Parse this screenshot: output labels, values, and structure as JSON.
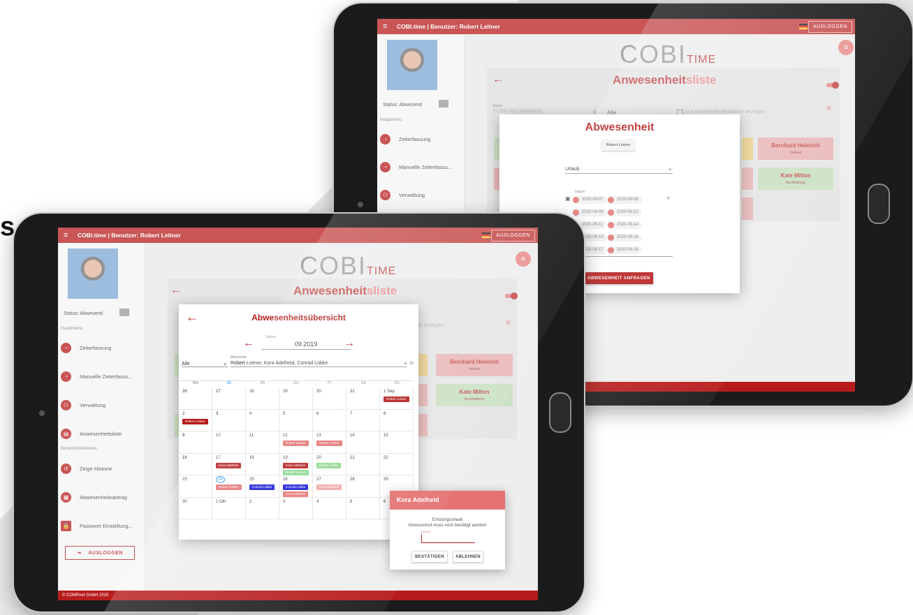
{
  "stray_letter": "s",
  "back_tablet": {
    "topbar": {
      "title": "COBI.time | Benutzer: Robert Leitner",
      "logout": "AUSLOGGEN"
    },
    "sidebar": {
      "status": "Status: Abwesend",
      "hauptmenu": "Hauptmenü",
      "items": [
        {
          "label": "Zeiterfassung",
          "icon": "clock-icon"
        },
        {
          "label": "Manuelle Zeiterfassu...",
          "icon": "edit-clock-icon"
        },
        {
          "label": "Verwaltung",
          "icon": "people-icon"
        }
      ]
    },
    "logo": {
      "main": "COBI",
      "suffix": "TIME"
    },
    "panel_title": {
      "main": "Anwesenheit",
      "rest": "sliste"
    },
    "search_label": "Suche",
    "search_placeholder": "Suche nach Mitarbeiter",
    "filter_value": "Alle",
    "only_present": "Nur anwesende Mitarbeiter anzeigen",
    "cards": [
      {
        "name": "Bernhard Heinrich",
        "dept": "Verkauf",
        "color": "#e3a5a5"
      },
      {
        "name": "Kate Milton",
        "dept": "Buchhaltung",
        "color": "#bcd9b2"
      }
    ],
    "dialog": {
      "title": "Abwesenheit",
      "user_button": "Robert Leitner",
      "type": "Urlaub",
      "date_label": "Datum",
      "dates": [
        "2020-09-07",
        "2020-09-08",
        "2020-09-09",
        "2020-09-10",
        "2020-09-11",
        "2020-09-14",
        "2020-09-15",
        "2020-09-16",
        "2020-09-17",
        "2020-09-18"
      ],
      "submit": "ABWESENHEIT ANFRAGEN"
    }
  },
  "front_tablet": {
    "topbar": {
      "title": "COBI.time | Benutzer: Robert Leitner",
      "logout": "AUSLOGGEN"
    },
    "sidebar": {
      "status": "Status: Abwesend",
      "hauptmenu": "Hauptmenü",
      "items": [
        {
          "label": "Zeiterfassung",
          "icon": "clock-icon"
        },
        {
          "label": "Manuelle Zeiterfassu...",
          "icon": "edit-clock-icon"
        },
        {
          "label": "Verwaltung",
          "icon": "people-icon"
        },
        {
          "label": "Anwesenheitsliste",
          "icon": "list-icon"
        }
      ],
      "subhead": "Benutzerfunktionen",
      "items2": [
        {
          "label": "Zeige Historie",
          "icon": "history-icon"
        },
        {
          "label": "Abwesenheitsantrag",
          "icon": "calendar-icon"
        },
        {
          "label": "Passwort Einstellung...",
          "icon": "lock-icon"
        }
      ],
      "logout": "AUSLOGGEN"
    },
    "logo": {
      "main": "COBI",
      "suffix": "TIME"
    },
    "panel_title": {
      "main": "Anwesenheit",
      "rest": "sliste"
    },
    "only_present": "er anzeigen",
    "cards": [
      {
        "name": "Bernhard Heinrich",
        "dept": "Verkauf"
      },
      {
        "name": "Kate Milton",
        "dept": "Buchhaltung"
      }
    ],
    "overview": {
      "title": "Abwesenheitsübersicht",
      "date_label": "Datum",
      "month": "09.2019",
      "filter": "Alle",
      "employees_label": "Mitarbeiter",
      "employees": "Robert Leitner, Kora Adelheid, Conrad Lübke",
      "weekdays": [
        "Mo",
        "Di",
        "Mi",
        "Do",
        "Fr",
        "Sa",
        "So"
      ],
      "weeks": [
        [
          "26",
          "27",
          "28",
          "29",
          "30",
          "31",
          "1 Sep"
        ],
        [
          "2",
          "3",
          "4",
          "5",
          "6",
          "7",
          "8"
        ],
        [
          "9",
          "10",
          "11",
          "12",
          "13",
          "14",
          "15"
        ],
        [
          "16",
          "17",
          "18",
          "19",
          "20",
          "21",
          "22"
        ],
        [
          "23",
          "24",
          "25",
          "26",
          "27",
          "28",
          "29"
        ],
        [
          "30",
          "1 Okt",
          "2",
          "3",
          "4",
          "5",
          "6"
        ]
      ],
      "events": [
        {
          "week": 0,
          "day": 6,
          "slot": 0,
          "label": "Robert Leitner",
          "style": "dr"
        },
        {
          "week": 1,
          "day": 0,
          "slot": 0,
          "label": "Robert Leitner",
          "style": "dr"
        },
        {
          "week": 2,
          "day": 3,
          "slot": 0,
          "label": "Robert Leitner",
          "style": "pk"
        },
        {
          "week": 2,
          "day": 4,
          "slot": 0,
          "label": "Robert Leitner",
          "style": "pk"
        },
        {
          "week": 3,
          "day": 1,
          "slot": 0,
          "label": "Kora Adelheid",
          "style": "dr"
        },
        {
          "week": 3,
          "day": 3,
          "slot": 0,
          "label": "Kora Adelheid",
          "style": "dr"
        },
        {
          "week": 3,
          "day": 3,
          "slot": 1,
          "label": "Robert Leitner",
          "style": "gr"
        },
        {
          "week": 3,
          "day": 4,
          "slot": 0,
          "label": "Robert Lübke",
          "style": "gr"
        },
        {
          "week": 4,
          "day": 1,
          "slot": 0,
          "label": "Robert Leitner",
          "style": "pk"
        },
        {
          "week": 4,
          "day": 2,
          "slot": 0,
          "label": "Conrad Lübke",
          "style": "bl"
        },
        {
          "week": 4,
          "day": 3,
          "slot": 0,
          "label": "Conrad Lübke",
          "style": "bl"
        },
        {
          "week": 4,
          "day": 3,
          "slot": 1,
          "label": "Kora Adelheid",
          "style": "pk"
        },
        {
          "week": 4,
          "day": 4,
          "slot": 0,
          "label": "Kora Adelheid",
          "style": "lp"
        }
      ]
    },
    "popup": {
      "name": "Kora Adelheid",
      "reason": "Erholungsurlaub",
      "note": "Abwesenheit muss noch bestätigt werden!",
      "field_label": "Grund",
      "confirm": "BESTÄTIGEN",
      "reject": "ABLEHNEN"
    },
    "footer": "© COMPnet GmbH 2020"
  }
}
